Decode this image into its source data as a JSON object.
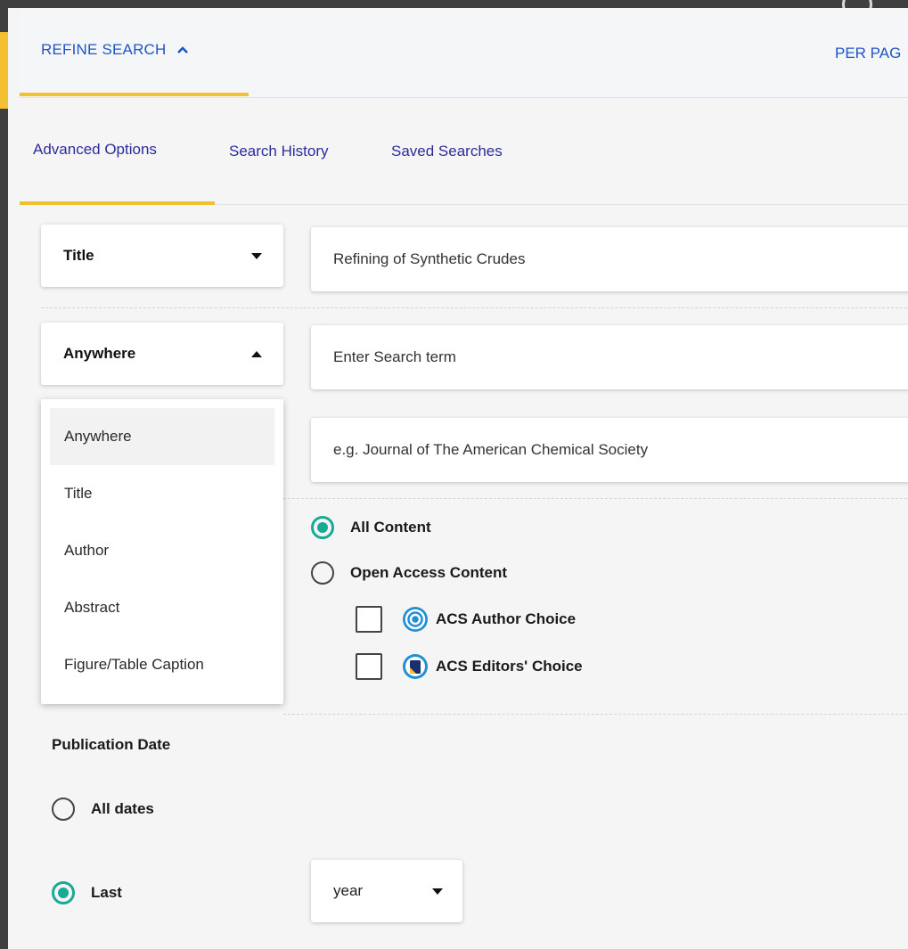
{
  "header": {
    "refine_label": "REFINE SEARCH",
    "per_page_label": "PER PAG"
  },
  "tabs": [
    {
      "label": "Advanced Options",
      "active": true
    },
    {
      "label": "Search History",
      "active": false
    },
    {
      "label": "Saved Searches",
      "active": false
    }
  ],
  "rows": {
    "row1": {
      "field": "Title",
      "value": "Refining of Synthetic Crudes"
    },
    "row2": {
      "field": "Anywhere",
      "placeholder": "Enter Search term"
    },
    "row3": {
      "placeholder": "e.g. Journal of The American Chemical Society"
    }
  },
  "dropdown": {
    "options": [
      "Anywhere",
      "Title",
      "Author",
      "Abstract",
      "Figure/Table Caption"
    ],
    "selected": "Anywhere"
  },
  "content_filter": {
    "all_content": "All Content",
    "open_access": "Open Access Content",
    "selected": "All Content",
    "author_choice": "ACS Author Choice",
    "editors_choice": "ACS Editors' Choice"
  },
  "publication_date": {
    "title": "Publication Date",
    "all_dates": "All dates",
    "last": "Last",
    "selected": "Last",
    "unit": "year"
  },
  "colors": {
    "accent_gold": "#f2c030",
    "link_blue": "#1f55c8",
    "tab_text": "#2d2d9a",
    "radio_teal": "#1aa997",
    "badge_blue": "#1f8fd6"
  }
}
